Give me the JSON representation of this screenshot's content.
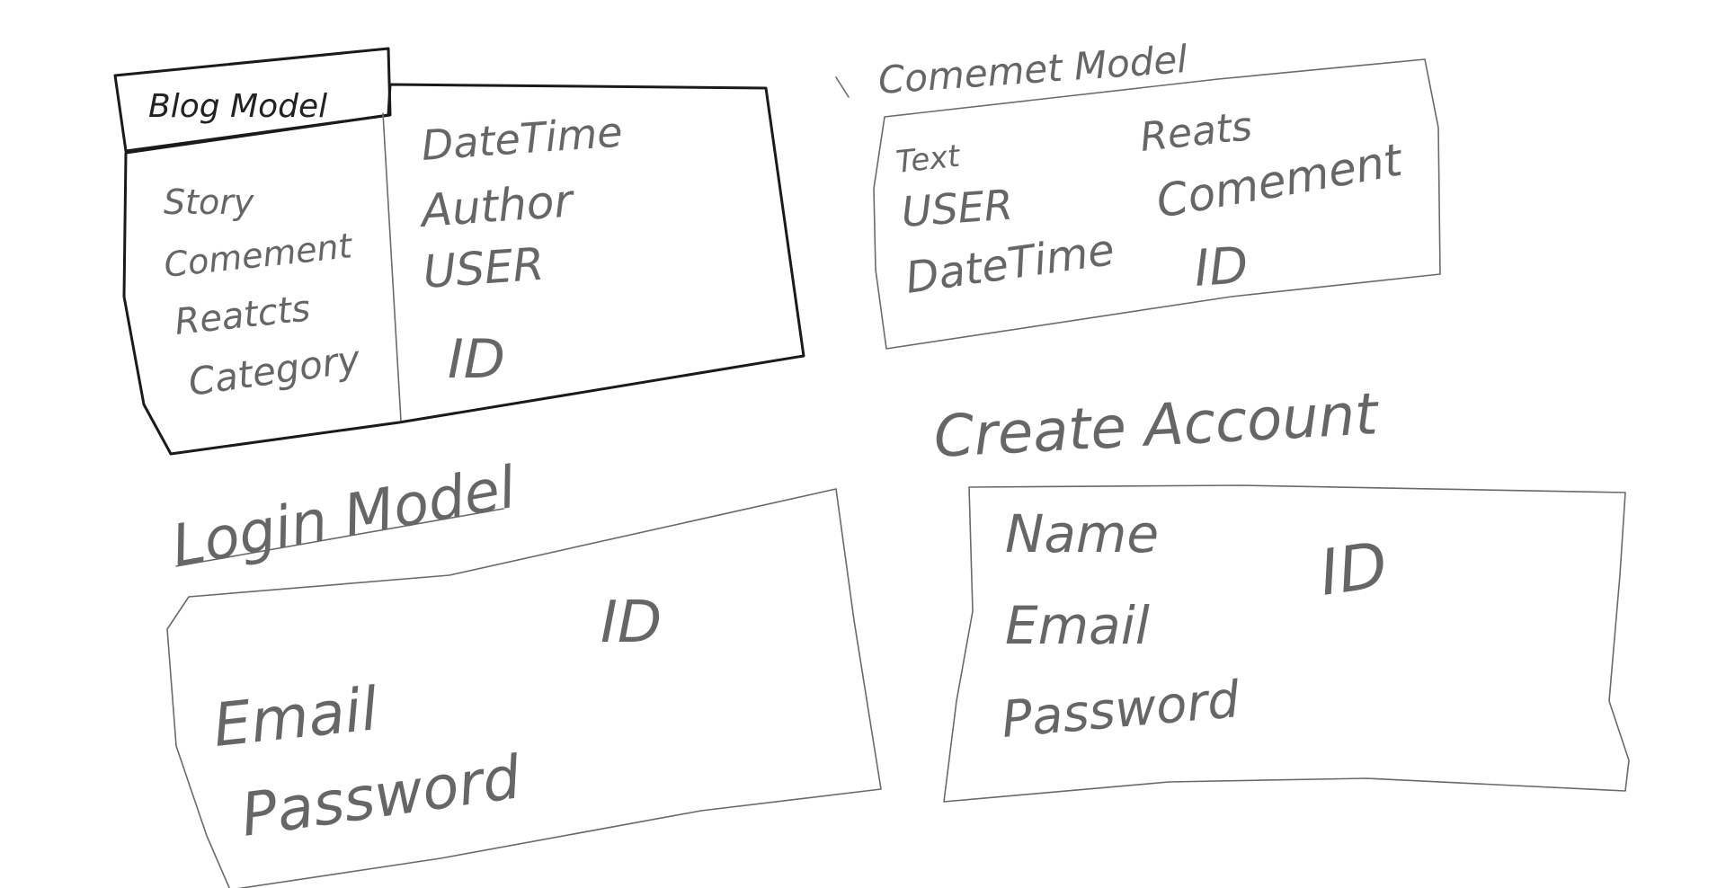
{
  "blog_model": {
    "title": "Blog Model",
    "left_fields": [
      "Story",
      "Comement",
      "Reatcts",
      "Category"
    ],
    "right_fields": [
      "DateTime",
      "Author",
      "USER",
      "ID"
    ]
  },
  "comment_model": {
    "title": "Comemet Model",
    "left_fields": [
      "Text",
      "USER",
      "DateTime"
    ],
    "right_fields": [
      "Reats",
      "Comement",
      "ID"
    ]
  },
  "create_account": {
    "title": "Create Account",
    "fields": [
      "Name",
      "Email",
      "Password"
    ],
    "id_label": "ID"
  },
  "login_model": {
    "title": "Login Model",
    "fields": [
      "Email",
      "Password"
    ],
    "id_label": "ID"
  },
  "colors": {
    "ink_bold": "#1a1a1a",
    "ink_light": "#6a6a6a",
    "background": "#ffffff"
  }
}
